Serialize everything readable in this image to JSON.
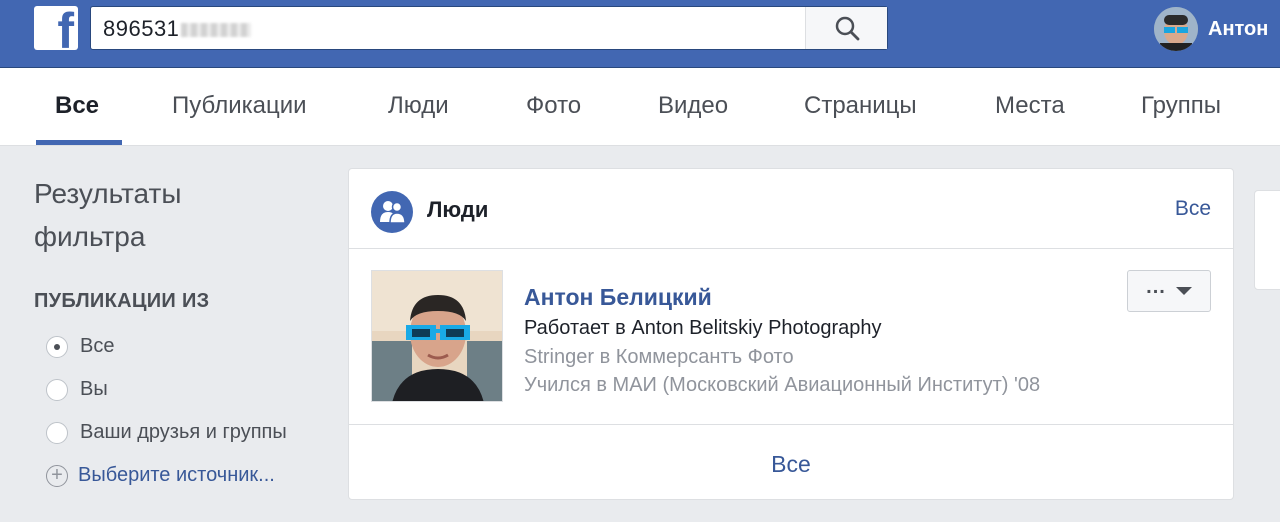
{
  "header": {
    "search_value": "896531",
    "user_name": "Антон"
  },
  "tabs": [
    {
      "label": "Все",
      "active": true
    },
    {
      "label": "Публикации"
    },
    {
      "label": "Люди"
    },
    {
      "label": "Фото"
    },
    {
      "label": "Видео"
    },
    {
      "label": "Страницы"
    },
    {
      "label": "Места"
    },
    {
      "label": "Группы"
    }
  ],
  "filter": {
    "title": "Результаты фильтра",
    "section": "ПУБЛИКАЦИИ ИЗ",
    "options": [
      {
        "label": "Все",
        "checked": true
      },
      {
        "label": "Вы"
      },
      {
        "label": "Ваши друзья и группы"
      }
    ],
    "choose_source": "Выберите источник..."
  },
  "people_card": {
    "title": "Люди",
    "see_all_top": "Все",
    "person": {
      "name": "Антон Белицкий",
      "line1": "Работает в Anton Belitskiy Photography",
      "line2": "Stringer в Коммерсантъ Фото",
      "line3": "Учился в МАИ (Московский Авиационный Институт) '08"
    },
    "see_all_bottom": "Все"
  },
  "colors": {
    "brand_blue": "#4267b2",
    "link_blue": "#385898",
    "background": "#e9ebee"
  },
  "icons": [
    "facebook-logo-icon",
    "search-icon",
    "people-icon",
    "more-dots-icon",
    "caret-down-icon",
    "plus-circle-icon"
  ]
}
